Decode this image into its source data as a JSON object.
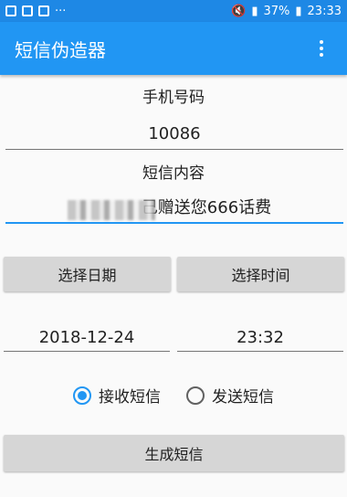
{
  "status": {
    "time": "23:33",
    "battery": "37%"
  },
  "appbar": {
    "title": "短信伪造器"
  },
  "form": {
    "phone_label": "手机号码",
    "phone_value": "10086",
    "content_label": "短信内容",
    "content_value": "己赠送您666话费",
    "date_button": "选择日期",
    "time_button": "选择时间",
    "date_value": "2018-12-24",
    "time_value": "23:32",
    "radio_receive": "接收短信",
    "radio_send": "发送短信",
    "generate_button": "生成短信"
  }
}
